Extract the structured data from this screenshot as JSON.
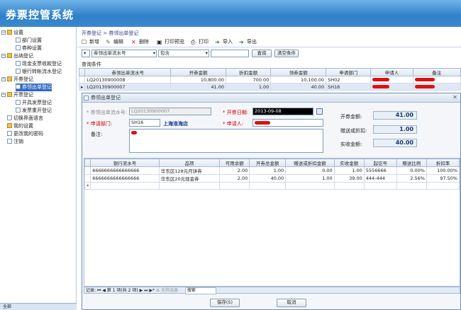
{
  "app": {
    "title": "券票控管系统"
  },
  "sidebar": {
    "items": [
      {
        "label": "设置",
        "level": 0,
        "type": "folder"
      },
      {
        "label": "部门设置",
        "level": 1,
        "type": "page"
      },
      {
        "label": "券种设置",
        "level": 1,
        "type": "page"
      },
      {
        "label": "出纳登记",
        "level": 0,
        "type": "folder"
      },
      {
        "label": "现金支票收款登记",
        "level": 1,
        "type": "page"
      },
      {
        "label": "银行转帐流水登记",
        "level": 1,
        "type": "page"
      },
      {
        "label": "开券登记",
        "level": 0,
        "type": "folder"
      },
      {
        "label": "券领出单登记",
        "level": 1,
        "type": "page",
        "selected": true
      },
      {
        "label": "开票登记",
        "level": 0,
        "type": "folder"
      },
      {
        "label": "开具发票登记",
        "level": 1,
        "type": "page"
      },
      {
        "label": "发票重开登记",
        "level": 1,
        "type": "page"
      },
      {
        "label": "切换界面语言",
        "level": 0,
        "type": "page"
      },
      {
        "label": "我的设置",
        "level": 0,
        "type": "folder"
      },
      {
        "label": "更改我的密码",
        "level": 0,
        "type": "page"
      },
      {
        "label": "注销",
        "level": 0,
        "type": "page"
      }
    ],
    "status": "全部"
  },
  "breadcrumb": "开券登记 > 券领出单登记",
  "toolbar": {
    "new": "新增",
    "edit": "编辑",
    "delete": "删除",
    "print_preview": "打印预览",
    "print": "打印",
    "import": "导入",
    "export": "导出"
  },
  "filter": {
    "field": "券领出单流水号",
    "op": "包含",
    "value": "",
    "search": "查询",
    "clear": "清空条件"
  },
  "query_label": "查询条件",
  "list": {
    "headers": [
      "券领出单流水号",
      "开券金额",
      "折扣金额",
      "领券金额",
      "申请部门",
      "申请人",
      "备注"
    ],
    "rows": [
      [
        "LQ20130900008",
        "10,800.00",
        "700.00",
        "10,100.00",
        "SH02"
      ],
      [
        "LQ20130900007",
        "41.00",
        "1.00",
        "40.00",
        "SH16"
      ]
    ]
  },
  "dialog": {
    "title": "券领出单登记",
    "serial_label": "券领出单流水号:",
    "serial_value": "LQ20130900007",
    "date_label": "开券日期:",
    "date_value": "2013-09-08",
    "dept_label": "申请部门:",
    "dept_code": "SH16",
    "dept_name": "上海淮海店",
    "applicant_label": "申请人:",
    "remark_label": "备注:",
    "open_amount_label": "开券金额:",
    "open_amount": "41.00",
    "discount_label": "赠送或折扣:",
    "discount": "1.00",
    "actual_label": "实收金额:",
    "actual": "40.00",
    "detail": {
      "headers": [
        "银行流水号",
        "品项",
        "可用余额",
        "开券总金额",
        "赠送或折扣金额",
        "实收金额",
        "起讫号",
        "赠送比例",
        "折扣率"
      ],
      "rows": [
        [
          "6666666666666666",
          "华东区128元月饼券",
          "2.00",
          "1.00",
          "0.00",
          "1.00",
          "5556666",
          "0.00%",
          "100.00%"
        ],
        [
          "6666666666666666",
          "华东区20元现金券",
          "2.00",
          "40.00",
          "1.00",
          "39.00",
          "444-444",
          "2.56%",
          "97.50%"
        ]
      ],
      "new_row_marker": "*"
    },
    "nav": {
      "record_label": "记录:",
      "position": "第 1 项(共 2 项)",
      "no_filter": "无筛选器",
      "search": "搜索"
    },
    "save": "保存(S)",
    "cancel": "取消"
  }
}
